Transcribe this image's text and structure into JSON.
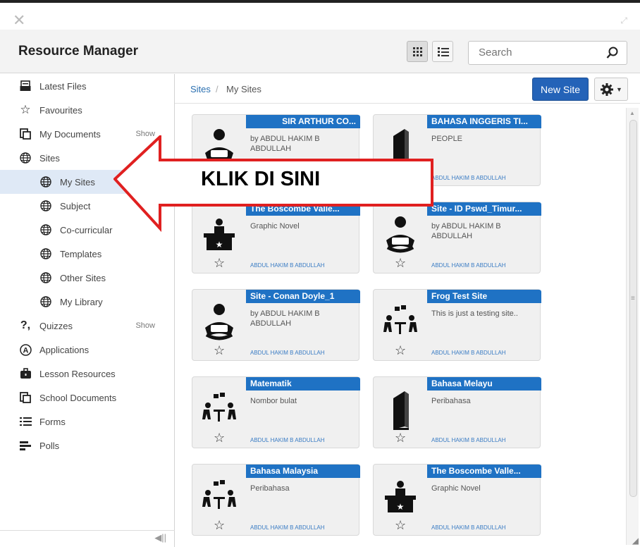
{
  "app": {
    "title": "Resource Manager"
  },
  "search": {
    "placeholder": "Search"
  },
  "sidebar": {
    "items": [
      {
        "label": "Latest Files",
        "icon": "inbox-icon"
      },
      {
        "label": "Favourites",
        "icon": "star-icon"
      },
      {
        "label": "My Documents",
        "icon": "documents-icon",
        "show": "Show"
      },
      {
        "label": "Sites",
        "icon": "globe-icon"
      },
      {
        "label": "My Sites",
        "icon": "globe-icon",
        "active": true
      },
      {
        "label": "Subject",
        "icon": "globe-icon"
      },
      {
        "label": "Co-curricular",
        "icon": "globe-icon"
      },
      {
        "label": "Templates",
        "icon": "globe-icon"
      },
      {
        "label": "Other Sites",
        "icon": "globe-icon"
      },
      {
        "label": "My Library",
        "icon": "globe-icon"
      },
      {
        "label": "Quizzes",
        "icon": "quiz-icon",
        "show": "Show"
      },
      {
        "label": "Applications",
        "icon": "applications-icon"
      },
      {
        "label": "Lesson Resources",
        "icon": "briefcase-icon"
      },
      {
        "label": "School Documents",
        "icon": "documents-icon"
      },
      {
        "label": "Forms",
        "icon": "forms-icon"
      },
      {
        "label": "Polls",
        "icon": "polls-icon"
      }
    ]
  },
  "breadcrumb": {
    "root": "Sites",
    "separator": "/",
    "current": "My Sites"
  },
  "toolbar": {
    "new_site_label": "New Site"
  },
  "cards": [
    {
      "title": "SIR ARTHUR CO...",
      "desc": "by ABDUL HAKIM B ABDULLAH",
      "author": "",
      "icon": "reader-icon",
      "align": "right"
    },
    {
      "title": "BAHASA INGGERIS TI...",
      "desc": "PEOPLE",
      "author": "ABDUL HAKIM B ABDULLAH",
      "icon": "book-icon",
      "align": "left"
    },
    {
      "title": "The Boscombe Valle...",
      "desc": "Graphic Novel",
      "author": "ABDUL HAKIM B ABDULLAH",
      "icon": "teacher-desk-icon",
      "align": "left"
    },
    {
      "title": "Site - ID Pswd_Timur...",
      "desc": "by ABDUL HAKIM B ABDULLAH",
      "author": "ABDUL HAKIM B ABDULLAH",
      "icon": "reader-icon",
      "align": "left"
    },
    {
      "title": "Site - Conan Doyle_1",
      "desc": "by ABDUL HAKIM B ABDULLAH",
      "author": "ABDUL HAKIM B ABDULLAH",
      "icon": "reader-icon",
      "align": "left"
    },
    {
      "title": "Frog Test Site",
      "desc": "This is just a testing site..",
      "author": "ABDUL HAKIM B ABDULLAH",
      "icon": "discussion-icon",
      "align": "left"
    },
    {
      "title": "Matematik",
      "desc": "Nombor bulat",
      "author": "ABDUL HAKIM B ABDULLAH",
      "icon": "discussion-icon",
      "align": "left"
    },
    {
      "title": "Bahasa Melayu",
      "desc": "Peribahasa",
      "author": "ABDUL HAKIM B ABDULLAH",
      "icon": "book-icon",
      "align": "left"
    },
    {
      "title": "Bahasa Malaysia",
      "desc": "Peribahasa",
      "author": "ABDUL HAKIM B ABDULLAH",
      "icon": "discussion-icon",
      "align": "left"
    },
    {
      "title": "The Boscombe Valle...",
      "desc": "Graphic Novel",
      "author": "ABDUL HAKIM B ABDULLAH",
      "icon": "teacher-desk-icon",
      "align": "left"
    }
  ],
  "callout": {
    "text": "KLIK  DI SINI",
    "color": "#e02020"
  },
  "colors": {
    "accent": "#1f72c4",
    "active_nav": "#dfe9f6"
  }
}
